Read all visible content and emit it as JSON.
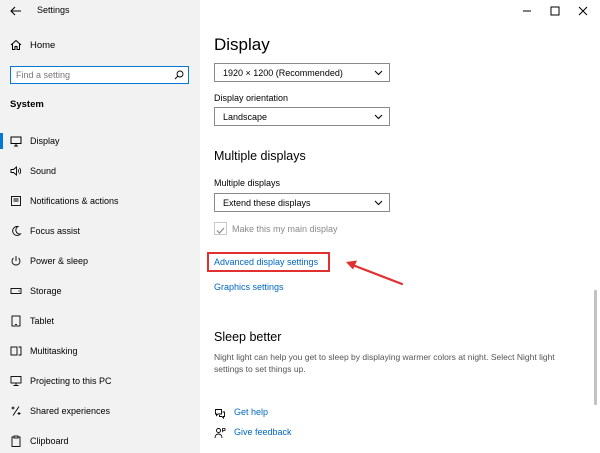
{
  "window": {
    "title": "Settings",
    "controls": [
      "minimize",
      "maximize",
      "close"
    ]
  },
  "sidebar": {
    "home_label": "Home",
    "search_placeholder": "Find a setting",
    "section_title": "System",
    "items": [
      {
        "label": "Display",
        "icon": "monitor-icon",
        "active": true
      },
      {
        "label": "Sound",
        "icon": "speaker-icon"
      },
      {
        "label": "Notifications & actions",
        "icon": "notification-icon"
      },
      {
        "label": "Focus assist",
        "icon": "moon-icon"
      },
      {
        "label": "Power & sleep",
        "icon": "power-icon"
      },
      {
        "label": "Storage",
        "icon": "storage-icon"
      },
      {
        "label": "Tablet",
        "icon": "tablet-icon"
      },
      {
        "label": "Multitasking",
        "icon": "multitasking-icon"
      },
      {
        "label": "Projecting to this PC",
        "icon": "projector-icon"
      },
      {
        "label": "Shared experiences",
        "icon": "shared-icon"
      },
      {
        "label": "Clipboard",
        "icon": "clipboard-icon"
      }
    ]
  },
  "main": {
    "title": "Display",
    "resolution_value": "1920 × 1200 (Recommended)",
    "orientation_label": "Display orientation",
    "orientation_value": "Landscape",
    "multiple_heading": "Multiple displays",
    "multiple_label": "Multiple displays",
    "multiple_value": "Extend these displays",
    "main_display_label": "Make this my main display",
    "main_display_checked": true,
    "advanced_link": "Advanced display settings",
    "graphics_link": "Graphics settings",
    "sleep_heading": "Sleep better",
    "sleep_text": "Night light can help you get to sleep by displaying warmer colors at night. Select Night light settings to set things up.",
    "help_link": "Get help",
    "feedback_link": "Give feedback"
  },
  "colors": {
    "accent": "#0078d7",
    "link": "#0067c0",
    "annotation": "#e03030"
  }
}
